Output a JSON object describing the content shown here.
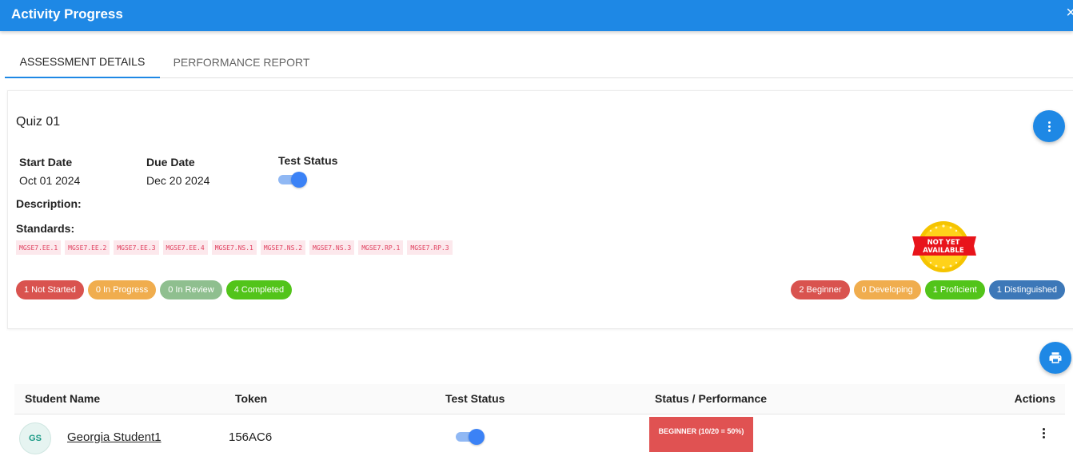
{
  "window": {
    "title": "Activity Progress",
    "close_label": "×"
  },
  "tabs": [
    {
      "label": "ASSESSMENT DETAILS",
      "active": true
    },
    {
      "label": "PERFORMANCE REPORT",
      "active": false
    }
  ],
  "quiz": {
    "title": "Quiz 01",
    "start_date_label": "Start Date",
    "start_date": "Oct 01 2024",
    "due_date_label": "Due Date",
    "due_date": "Dec 20 2024",
    "test_status_label": "Test Status",
    "test_status_on": true,
    "description_label": "Description:",
    "standards_label": "Standards:",
    "standards": [
      "MGSE7.EE.1",
      "MGSE7.EE.2",
      "MGSE7.EE.3",
      "MGSE7.EE.4",
      "MGSE7.NS.1",
      "MGSE7.NS.2",
      "MGSE7.NS.3",
      "MGSE7.RP.1",
      "MGSE7.RP.3"
    ],
    "status_counts": [
      {
        "label": "1 Not Started",
        "color": "#d9534f"
      },
      {
        "label": "0 In Progress",
        "color": "#f0ad4e"
      },
      {
        "label": "0 In Review",
        "color": "#8fbf8f"
      },
      {
        "label": "4 Completed",
        "color": "#52c41a"
      }
    ],
    "performance_counts": [
      {
        "label": "2 Beginner",
        "color": "#d9534f"
      },
      {
        "label": "0 Developing",
        "color": "#f0ad4e"
      },
      {
        "label": "1 Proficient",
        "color": "#52c41a"
      },
      {
        "label": "1 Distinguished",
        "color": "#3d78b8"
      }
    ],
    "badge_line1": "NOT YET",
    "badge_line2": "AVAILABLE"
  },
  "table": {
    "headers": {
      "name": "Student Name",
      "token": "Token",
      "status": "Test Status",
      "performance": "Status / Performance",
      "actions": "Actions"
    },
    "rows": [
      {
        "initials": "GS",
        "name": "Georgia Student1",
        "token": "156AC6",
        "test_status_on": true,
        "performance": "BEGINNER (10/20 = 50%)"
      }
    ]
  },
  "icons": {
    "more": "more-vertical-icon",
    "print": "printer-icon",
    "close": "close-icon"
  },
  "colors": {
    "primary": "#1e88e5",
    "toggle": "#3b82f6",
    "beginner": "#e05252"
  }
}
